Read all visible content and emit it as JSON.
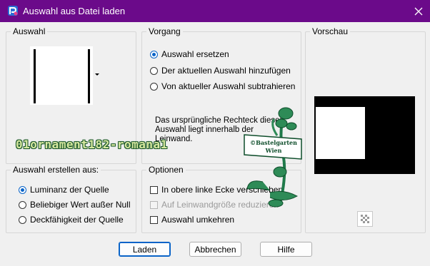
{
  "window": {
    "title": "Auswahl aus Datei laden",
    "close_icon": "close-icon",
    "app_icon": "paintshop-icon"
  },
  "auswahl": {
    "legend": "Auswahl"
  },
  "vorgang": {
    "legend": "Vorgang",
    "options": [
      {
        "label": "Auswahl ersetzen",
        "checked": true
      },
      {
        "label": "Der aktuellen Auswahl hinzufügen",
        "checked": false
      },
      {
        "label": "Von aktueller Auswahl subtrahieren",
        "checked": false
      }
    ],
    "info_line1": "Das ursprüngliche Rechteck dieser",
    "info_line2": "Auswahl liegt innerhalb der",
    "info_line3": "Leinwand."
  },
  "vorschau": {
    "legend": "Vorschau"
  },
  "erstellen": {
    "legend": "Auswahl erstellen aus:",
    "options": [
      {
        "label": "Luminanz der Quelle",
        "checked": true
      },
      {
        "label": "Beliebiger Wert außer Null",
        "checked": false
      },
      {
        "label": "Deckfähigkeit der Quelle",
        "checked": false
      }
    ]
  },
  "optionen": {
    "legend": "Optionen",
    "items": [
      {
        "label": "In obere linke Ecke verschieben",
        "checked": false,
        "disabled": false
      },
      {
        "label": "Auf Leinwandgröße reduzieren",
        "checked": false,
        "disabled": true
      },
      {
        "label": "Auswahl umkehren",
        "checked": false,
        "disabled": false
      }
    ]
  },
  "buttons": {
    "ok": "Laden",
    "cancel": "Abbrechen",
    "help": "Hilfe"
  },
  "overlay": {
    "watermark": "01ornament182-romana1",
    "stamp_line1": "©Bastelgarten",
    "stamp_line2": "Wien"
  },
  "colors": {
    "titlebar": "#6b0a8a",
    "accent": "#0a64c8",
    "watermark_green": "#1d5a2a"
  }
}
